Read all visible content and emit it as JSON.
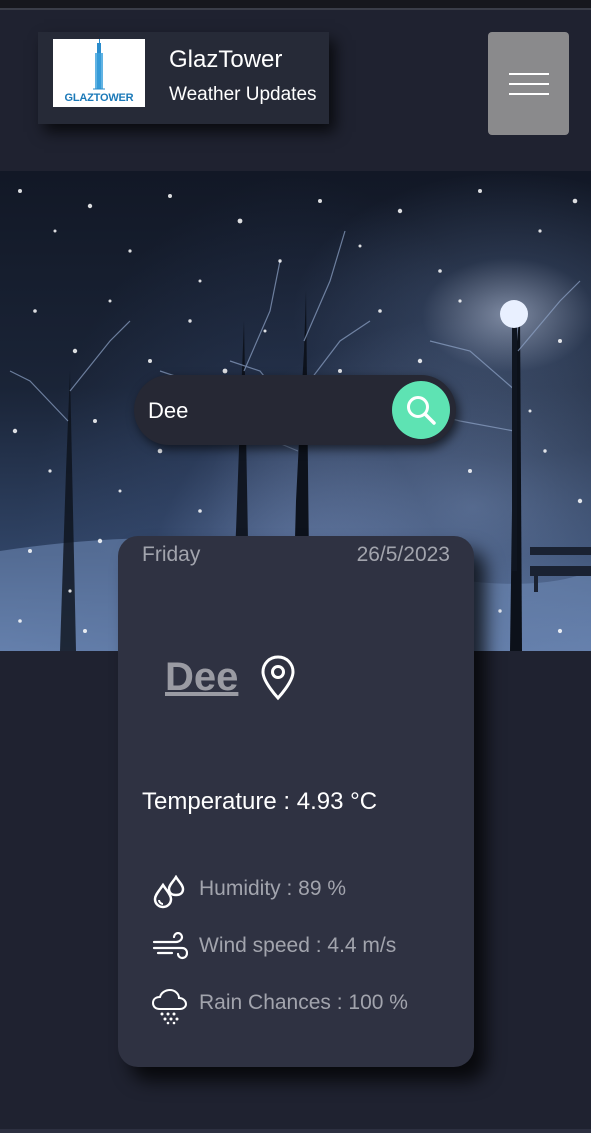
{
  "header": {
    "logo_text": "GLAZTOWER",
    "title": "GlazTower",
    "subtitle": "Weather Updates",
    "menu_icon": "hamburger-icon"
  },
  "search": {
    "value": "Dee",
    "button_icon": "search-icon",
    "button_color": "#5ee3b3"
  },
  "card": {
    "day": "Friday",
    "date": "26/5/2023",
    "city": "Dee",
    "location_icon": "map-pin-icon",
    "temperature_label": "Temperature : ",
    "temperature_value": "4.93 °C",
    "details": [
      {
        "icon": "humidity-icon",
        "label": "Humidity : 89 %"
      },
      {
        "icon": "wind-icon",
        "label": "Wind speed : 4.4 m/s"
      },
      {
        "icon": "rain-cloud-icon",
        "label": "Rain Chances : 100 %"
      }
    ]
  }
}
